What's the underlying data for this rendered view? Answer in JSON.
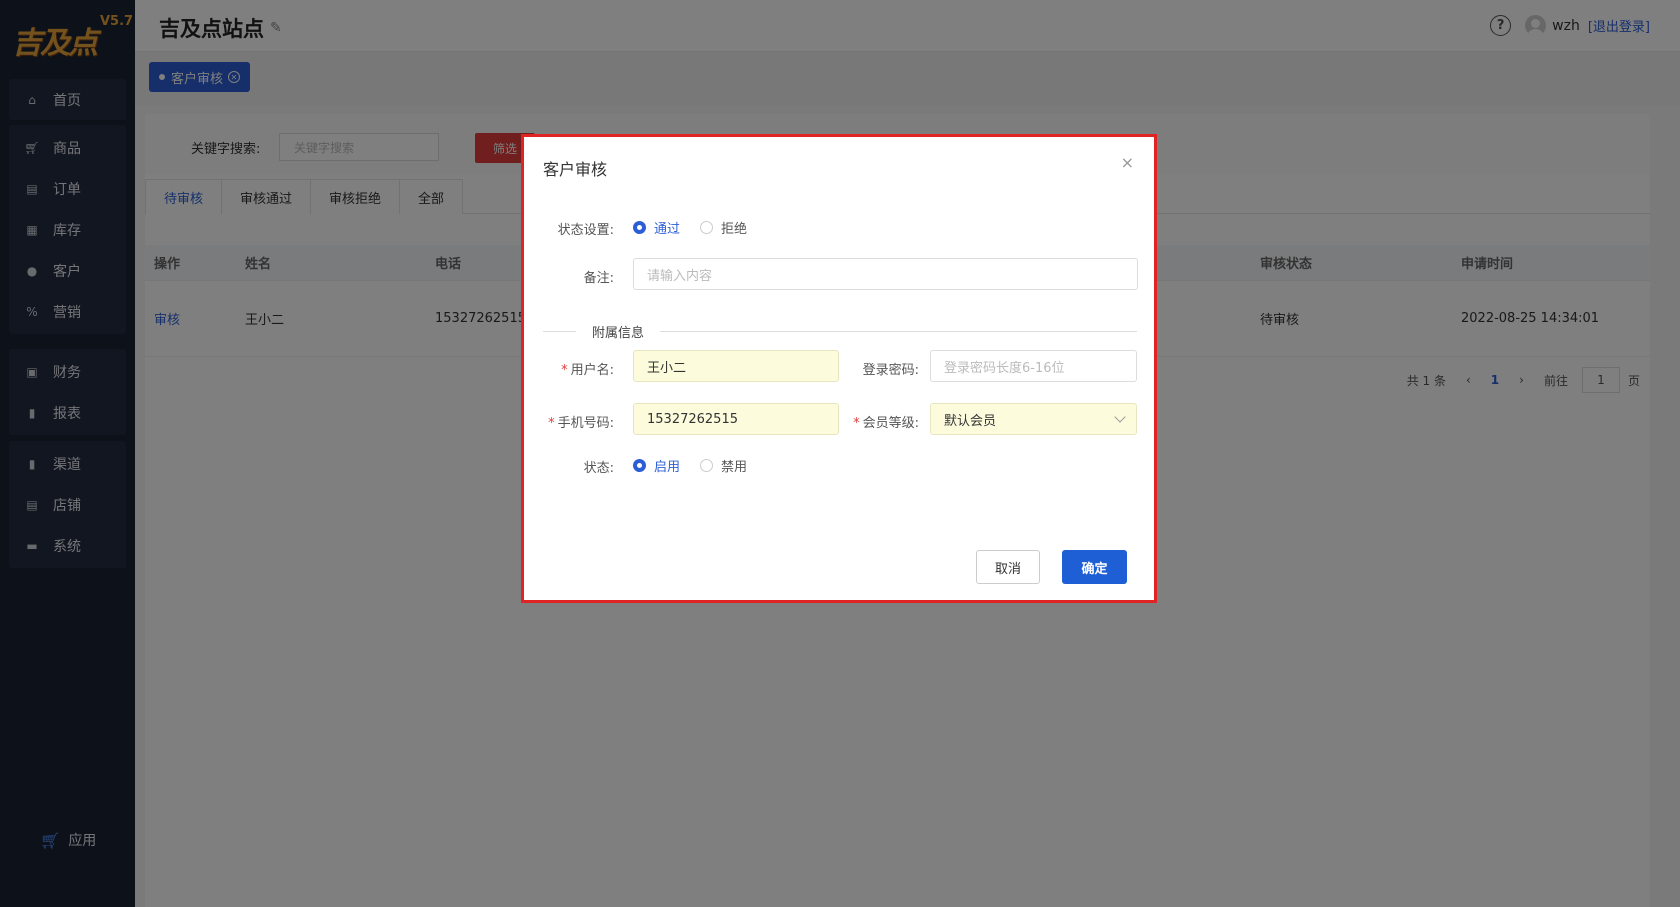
{
  "logo": {
    "text": "吉及点",
    "version": "V5.7"
  },
  "sidebar": {
    "groups": [
      [
        {
          "label": "首页",
          "icon": "home-icon"
        }
      ],
      [
        {
          "label": "商品",
          "icon": "cart-icon"
        },
        {
          "label": "订单",
          "icon": "order-icon"
        },
        {
          "label": "库存",
          "icon": "grid-icon"
        },
        {
          "label": "客户",
          "icon": "user-icon"
        },
        {
          "label": "营销",
          "icon": "percent-icon"
        }
      ],
      [
        {
          "label": "财务",
          "icon": "finance-icon"
        },
        {
          "label": "报表",
          "icon": "chart-icon"
        }
      ],
      [
        {
          "label": "渠道",
          "icon": "chart-icon"
        },
        {
          "label": "店铺",
          "icon": "store-icon"
        },
        {
          "label": "系统",
          "icon": "monitor-icon"
        }
      ]
    ],
    "app_label": "应用"
  },
  "header": {
    "title": "吉及点站点",
    "user": "wzh",
    "logout": "[退出登录]"
  },
  "tagbar": {
    "tag_label": "客户审核"
  },
  "filter": {
    "label": "关键字搜索:",
    "placeholder": "关键字搜索",
    "button": "筛选"
  },
  "tabs": [
    "待审核",
    "审核通过",
    "审核拒绝",
    "全部"
  ],
  "table": {
    "headers": {
      "op": "操作",
      "name": "姓名",
      "phone": "电话",
      "status": "审核状态",
      "time": "申请时间"
    },
    "row": {
      "op": "审核",
      "name": "王小二",
      "phone": "15327262515",
      "status": "待审核",
      "time": "2022-08-25 14:34:01"
    }
  },
  "pager": {
    "total": "共 1 条",
    "prev": "‹",
    "page": "1",
    "next": "›",
    "goto": "前往",
    "page_input": "1",
    "suffix": "页"
  },
  "modal": {
    "title": "客户审核",
    "close": "×",
    "status_label": "状态设置:",
    "status_options": {
      "pass": "通过",
      "reject": "拒绝"
    },
    "remark_label": "备注:",
    "remark_placeholder": "请输入内容",
    "section": "附属信息",
    "username_label": "用户名:",
    "username_value": "王小二",
    "password_label": "登录密码:",
    "password_placeholder": "登录密码长度6-16位",
    "phone_label": "手机号码:",
    "phone_value": "15327262515",
    "level_label": "会员等级:",
    "level_value": "默认会员",
    "state_label": "状态:",
    "state_options": {
      "enable": "启用",
      "disable": "禁用"
    },
    "cancel": "取消",
    "confirm": "确定",
    "required_mark": "*"
  },
  "colors": {
    "sidebar_bg": "#1b2233",
    "accent": "#2c5fd6",
    "danger": "#e23c3c",
    "highlight_border": "#e02424"
  }
}
